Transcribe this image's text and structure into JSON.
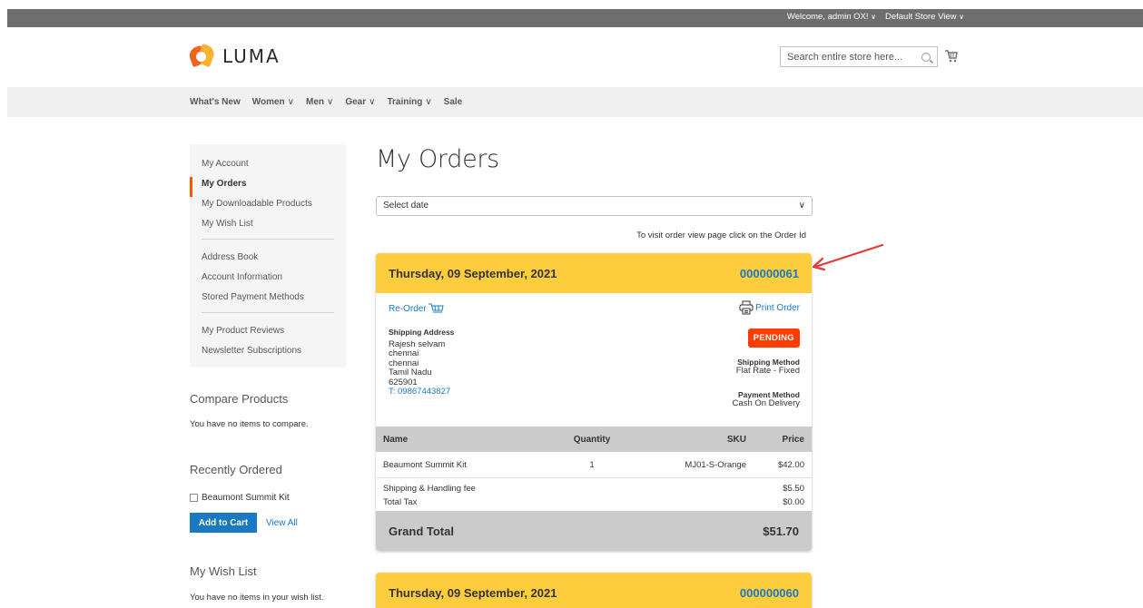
{
  "topbar": {
    "welcome": "Welcome, admin OX!",
    "store_view": "Default Store View"
  },
  "logo": {
    "text": "LUMA"
  },
  "search": {
    "placeholder": "Search entire store here..."
  },
  "nav": {
    "items": [
      "What's New",
      "Women",
      "Men",
      "Gear",
      "Training",
      "Sale"
    ]
  },
  "sidebar": {
    "group1": [
      "My Account",
      "My Orders",
      "My Downloadable Products",
      "My Wish List"
    ],
    "group2": [
      "Address Book",
      "Account Information",
      "Stored Payment Methods"
    ],
    "group3": [
      "My Product Reviews",
      "Newsletter Subscriptions"
    ]
  },
  "compare": {
    "title": "Compare Products",
    "empty": "You have no items to compare."
  },
  "recent": {
    "title": "Recently Ordered",
    "item": "Beaumont Summit Kit",
    "add_to_cart": "Add to Cart",
    "view_all": "View All"
  },
  "wishlist": {
    "title": "My Wish List",
    "empty": "You have no items in your wish list."
  },
  "page": {
    "title": "My Orders",
    "select_date": "Select date",
    "hint": "To visit order view page click on the Order Id"
  },
  "order1": {
    "date": "Thursday, 09 September, 2021",
    "id": "000000061",
    "reorder": "Re-Order",
    "print": "Print Order",
    "shipping_address_label": "Shipping Address",
    "address": [
      "Rajesh selvam",
      "chennai",
      "chennai",
      "Tamil Nadu",
      "625901"
    ],
    "phone": "T: 09867443827",
    "status": "PENDING",
    "shipping_method_label": "Shipping Method",
    "shipping_method": "Flat Rate - Fixed",
    "payment_method_label": "Payment Method",
    "payment_method": "Cash On Delivery",
    "table": {
      "headers": [
        "Name",
        "Quantity",
        "SKU",
        "Price"
      ],
      "row": [
        "Beaumont Summit Kit",
        "1",
        "MJ01-S-Orange",
        "$42.00"
      ]
    },
    "shipping_fee_label": "Shipping & Handling fee",
    "shipping_fee": "$5.50",
    "tax_label": "Total Tax",
    "tax": "$0.00",
    "grand_total_label": "Grand Total",
    "grand_total": "$51.70"
  },
  "order2": {
    "date": "Thursday, 09 September, 2021",
    "id": "000000060"
  },
  "colors": {
    "accent": "#1979c3",
    "order_header": "#fdcd3e",
    "status": "#ff3d00",
    "annotation_arrow": "#e53935"
  }
}
